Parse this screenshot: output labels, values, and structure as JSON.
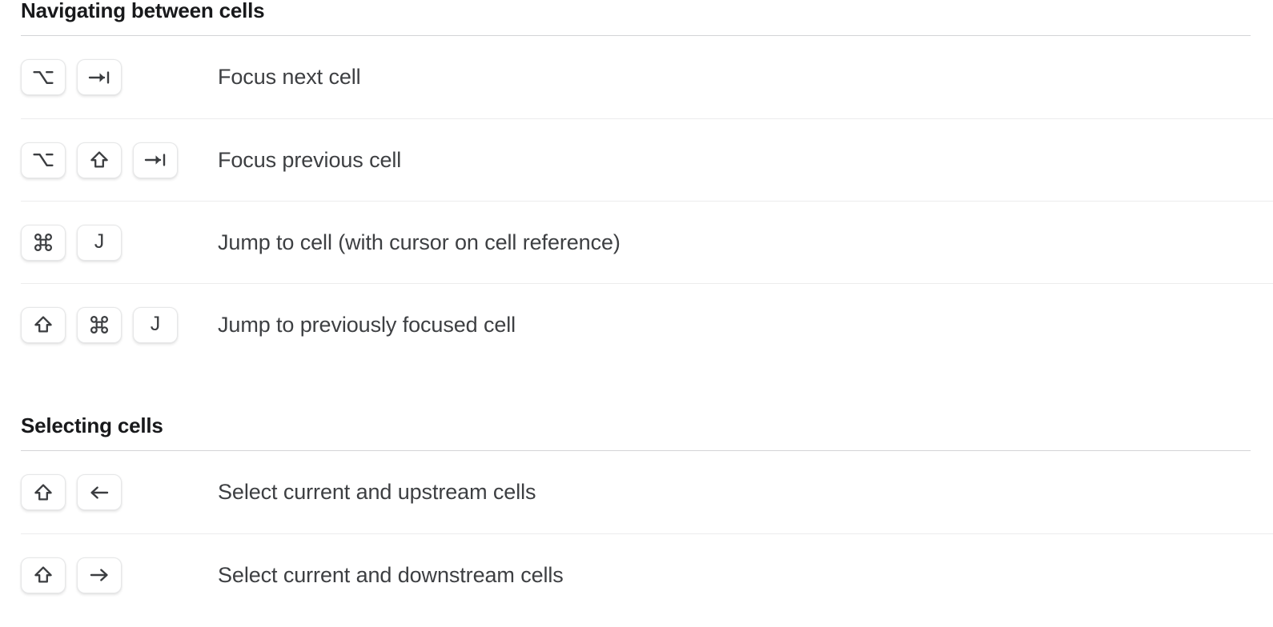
{
  "page": {
    "background_color": "#ffffff",
    "text_color": "#3d3f42",
    "heading_color": "#18191b",
    "rule_color": "#d3d4d6",
    "row_divider_color": "#ececed",
    "keycap_border_color": "#e6e7e8"
  },
  "sections": [
    {
      "heading": "Navigating between cells",
      "rows": [
        {
          "keys": [
            {
              "icon": "option-key-icon",
              "label": "⌥"
            },
            {
              "icon": "tab-key-icon",
              "label": "⇥"
            }
          ],
          "description": "Focus next cell"
        },
        {
          "keys": [
            {
              "icon": "option-key-icon",
              "label": "⌥"
            },
            {
              "icon": "shift-key-icon",
              "label": "⇧"
            },
            {
              "icon": "tab-key-icon",
              "label": "⇥"
            }
          ],
          "description": "Focus previous cell"
        },
        {
          "keys": [
            {
              "icon": "command-key-icon",
              "label": "⌘"
            },
            {
              "icon": "letter-key-icon",
              "label": "J"
            }
          ],
          "description": "Jump to cell (with cursor on cell reference)"
        },
        {
          "keys": [
            {
              "icon": "shift-key-icon",
              "label": "⇧"
            },
            {
              "icon": "command-key-icon",
              "label": "⌘"
            },
            {
              "icon": "letter-key-icon",
              "label": "J"
            }
          ],
          "description": "Jump to previously focused cell"
        }
      ]
    },
    {
      "heading": "Selecting cells",
      "rows": [
        {
          "keys": [
            {
              "icon": "shift-key-icon",
              "label": "⇧"
            },
            {
              "icon": "arrow-left-key-icon",
              "label": "←"
            }
          ],
          "description": "Select current and upstream cells"
        },
        {
          "keys": [
            {
              "icon": "shift-key-icon",
              "label": "⇧"
            },
            {
              "icon": "arrow-right-key-icon",
              "label": "→"
            }
          ],
          "description": "Select current and downstream cells"
        }
      ]
    }
  ]
}
